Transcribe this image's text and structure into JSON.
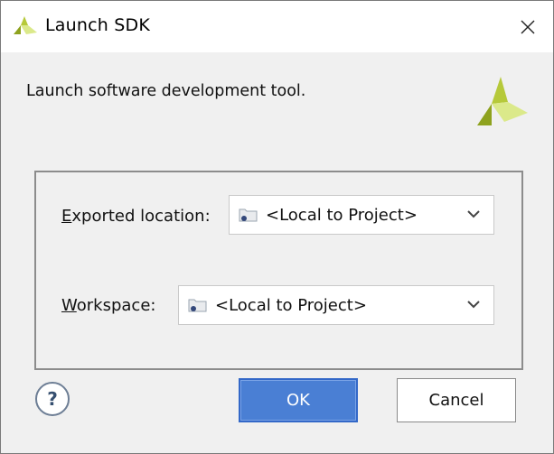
{
  "window": {
    "title": "Launch SDK",
    "close_icon": "close-icon"
  },
  "description": "Launch software development tool.",
  "form": {
    "exported_location": {
      "label_mnemonic": "E",
      "label_rest": "xported location:",
      "value": "<Local to Project>"
    },
    "workspace": {
      "label_mnemonic": "W",
      "label_rest": "orkspace:",
      "value": "<Local to Project>"
    }
  },
  "buttons": {
    "help": "?",
    "ok": "OK",
    "cancel": "Cancel"
  },
  "colors": {
    "accent": "#4a7fd4",
    "logo_light": "#cfe36a",
    "logo_dark": "#8ea21e"
  }
}
